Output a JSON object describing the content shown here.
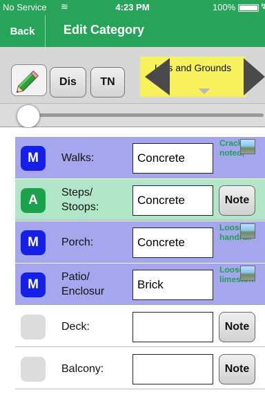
{
  "status": {
    "carrier": "No Service",
    "time": "4:23 PM",
    "battery": "100%"
  },
  "nav": {
    "back_label": "Back",
    "title": "Edit Category"
  },
  "toolbar": {
    "dis_label": "Dis",
    "tn_label": "TN",
    "category_label": "Lots and Grounds"
  },
  "slider": {
    "value": 0.0
  },
  "rows": [
    {
      "badge": "M",
      "label": "Walks:",
      "value": "Concrete",
      "note_text": "Cracks noted,",
      "has_thumb": true
    },
    {
      "badge": "A",
      "label": "Steps/ Stoops:",
      "value": "Concrete",
      "note_label": "Note"
    },
    {
      "badge": "M",
      "label": "Porch:",
      "value": "Concrete",
      "note_text": "Loose handrail",
      "has_thumb": true
    },
    {
      "badge": "M",
      "label": "Patio/ Enclosur",
      "value": "Brick",
      "note_text": "Loose limestone",
      "has_thumb": true
    },
    {
      "badge": "",
      "label": "Deck:",
      "value": "",
      "note_label": "Note"
    },
    {
      "badge": "",
      "label": "Balcony:",
      "value": "",
      "note_label": "Note"
    }
  ],
  "colors": {
    "header_green": "#28a45a",
    "maintenance_row": "#a6a6ee",
    "acceptable_row": "#b2e6c8",
    "badge_m": "#1420e6",
    "badge_a": "#1ea14c",
    "category_yellow": "#f7f15e",
    "note_text_green": "#1fa052"
  }
}
